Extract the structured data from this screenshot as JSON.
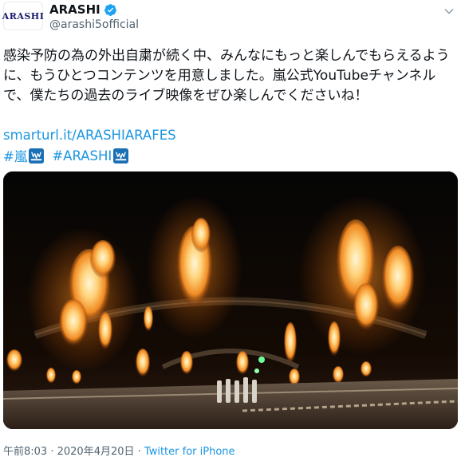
{
  "account": {
    "avatar_text": "ARASHI",
    "display_name": "ARASHI",
    "handle": "@arashi5official"
  },
  "tweet": {
    "text": "感染予防の為の外出自粛が続く中、みんなにもっと楽しんでもらえるように、もうひとつコンテンツを用意しました。嵐公式YouTubeチャンネルで、僕たちの過去のライブ映像をぜひ楽しんでくださいね！",
    "link": "smarturl.it/ARASHIARAFES",
    "hashtags": [
      "#嵐",
      "#ARASHI"
    ]
  },
  "footer": {
    "time": "午前8:03",
    "separator": " · ",
    "date": "2020年4月20日",
    "source": "Twitter for iPhone"
  },
  "colors": {
    "link": "#1b95e0",
    "verified": "#1da1f2",
    "muted": "#536471"
  },
  "icons": {
    "verified": "verified-badge-icon",
    "more": "chevron-down-icon",
    "hashtag_emoji": "arashi-hashflag-icon"
  }
}
